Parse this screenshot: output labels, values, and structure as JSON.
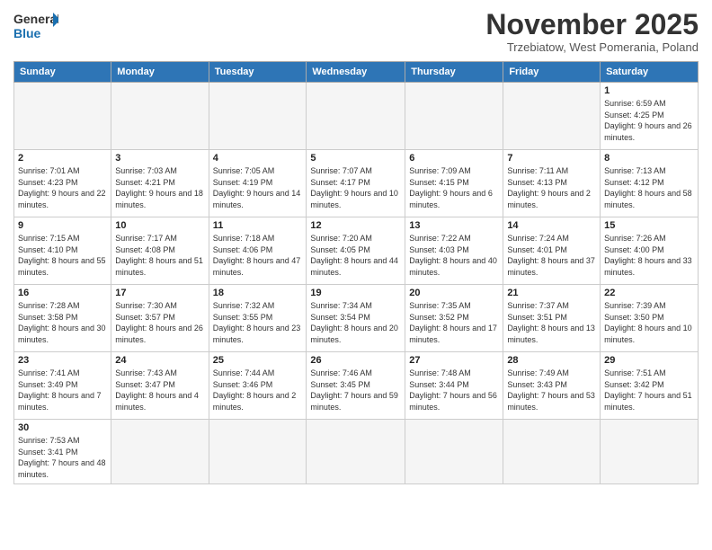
{
  "header": {
    "logo_general": "General",
    "logo_blue": "Blue",
    "month_title": "November 2025",
    "location": "Trzebiatow, West Pomerania, Poland"
  },
  "days_of_week": [
    "Sunday",
    "Monday",
    "Tuesday",
    "Wednesday",
    "Thursday",
    "Friday",
    "Saturday"
  ],
  "weeks": [
    [
      {
        "day": "",
        "info": ""
      },
      {
        "day": "",
        "info": ""
      },
      {
        "day": "",
        "info": ""
      },
      {
        "day": "",
        "info": ""
      },
      {
        "day": "",
        "info": ""
      },
      {
        "day": "",
        "info": ""
      },
      {
        "day": "1",
        "info": "Sunrise: 6:59 AM\nSunset: 4:25 PM\nDaylight: 9 hours and 26 minutes."
      }
    ],
    [
      {
        "day": "2",
        "info": "Sunrise: 7:01 AM\nSunset: 4:23 PM\nDaylight: 9 hours and 22 minutes."
      },
      {
        "day": "3",
        "info": "Sunrise: 7:03 AM\nSunset: 4:21 PM\nDaylight: 9 hours and 18 minutes."
      },
      {
        "day": "4",
        "info": "Sunrise: 7:05 AM\nSunset: 4:19 PM\nDaylight: 9 hours and 14 minutes."
      },
      {
        "day": "5",
        "info": "Sunrise: 7:07 AM\nSunset: 4:17 PM\nDaylight: 9 hours and 10 minutes."
      },
      {
        "day": "6",
        "info": "Sunrise: 7:09 AM\nSunset: 4:15 PM\nDaylight: 9 hours and 6 minutes."
      },
      {
        "day": "7",
        "info": "Sunrise: 7:11 AM\nSunset: 4:13 PM\nDaylight: 9 hours and 2 minutes."
      },
      {
        "day": "8",
        "info": "Sunrise: 7:13 AM\nSunset: 4:12 PM\nDaylight: 8 hours and 58 minutes."
      }
    ],
    [
      {
        "day": "9",
        "info": "Sunrise: 7:15 AM\nSunset: 4:10 PM\nDaylight: 8 hours and 55 minutes."
      },
      {
        "day": "10",
        "info": "Sunrise: 7:17 AM\nSunset: 4:08 PM\nDaylight: 8 hours and 51 minutes."
      },
      {
        "day": "11",
        "info": "Sunrise: 7:18 AM\nSunset: 4:06 PM\nDaylight: 8 hours and 47 minutes."
      },
      {
        "day": "12",
        "info": "Sunrise: 7:20 AM\nSunset: 4:05 PM\nDaylight: 8 hours and 44 minutes."
      },
      {
        "day": "13",
        "info": "Sunrise: 7:22 AM\nSunset: 4:03 PM\nDaylight: 8 hours and 40 minutes."
      },
      {
        "day": "14",
        "info": "Sunrise: 7:24 AM\nSunset: 4:01 PM\nDaylight: 8 hours and 37 minutes."
      },
      {
        "day": "15",
        "info": "Sunrise: 7:26 AM\nSunset: 4:00 PM\nDaylight: 8 hours and 33 minutes."
      }
    ],
    [
      {
        "day": "16",
        "info": "Sunrise: 7:28 AM\nSunset: 3:58 PM\nDaylight: 8 hours and 30 minutes."
      },
      {
        "day": "17",
        "info": "Sunrise: 7:30 AM\nSunset: 3:57 PM\nDaylight: 8 hours and 26 minutes."
      },
      {
        "day": "18",
        "info": "Sunrise: 7:32 AM\nSunset: 3:55 PM\nDaylight: 8 hours and 23 minutes."
      },
      {
        "day": "19",
        "info": "Sunrise: 7:34 AM\nSunset: 3:54 PM\nDaylight: 8 hours and 20 minutes."
      },
      {
        "day": "20",
        "info": "Sunrise: 7:35 AM\nSunset: 3:52 PM\nDaylight: 8 hours and 17 minutes."
      },
      {
        "day": "21",
        "info": "Sunrise: 7:37 AM\nSunset: 3:51 PM\nDaylight: 8 hours and 13 minutes."
      },
      {
        "day": "22",
        "info": "Sunrise: 7:39 AM\nSunset: 3:50 PM\nDaylight: 8 hours and 10 minutes."
      }
    ],
    [
      {
        "day": "23",
        "info": "Sunrise: 7:41 AM\nSunset: 3:49 PM\nDaylight: 8 hours and 7 minutes."
      },
      {
        "day": "24",
        "info": "Sunrise: 7:43 AM\nSunset: 3:47 PM\nDaylight: 8 hours and 4 minutes."
      },
      {
        "day": "25",
        "info": "Sunrise: 7:44 AM\nSunset: 3:46 PM\nDaylight: 8 hours and 2 minutes."
      },
      {
        "day": "26",
        "info": "Sunrise: 7:46 AM\nSunset: 3:45 PM\nDaylight: 7 hours and 59 minutes."
      },
      {
        "day": "27",
        "info": "Sunrise: 7:48 AM\nSunset: 3:44 PM\nDaylight: 7 hours and 56 minutes."
      },
      {
        "day": "28",
        "info": "Sunrise: 7:49 AM\nSunset: 3:43 PM\nDaylight: 7 hours and 53 minutes."
      },
      {
        "day": "29",
        "info": "Sunrise: 7:51 AM\nSunset: 3:42 PM\nDaylight: 7 hours and 51 minutes."
      }
    ],
    [
      {
        "day": "30",
        "info": "Sunrise: 7:53 AM\nSunset: 3:41 PM\nDaylight: 7 hours and 48 minutes."
      },
      {
        "day": "",
        "info": ""
      },
      {
        "day": "",
        "info": ""
      },
      {
        "day": "",
        "info": ""
      },
      {
        "day": "",
        "info": ""
      },
      {
        "day": "",
        "info": ""
      },
      {
        "day": "",
        "info": ""
      }
    ]
  ]
}
